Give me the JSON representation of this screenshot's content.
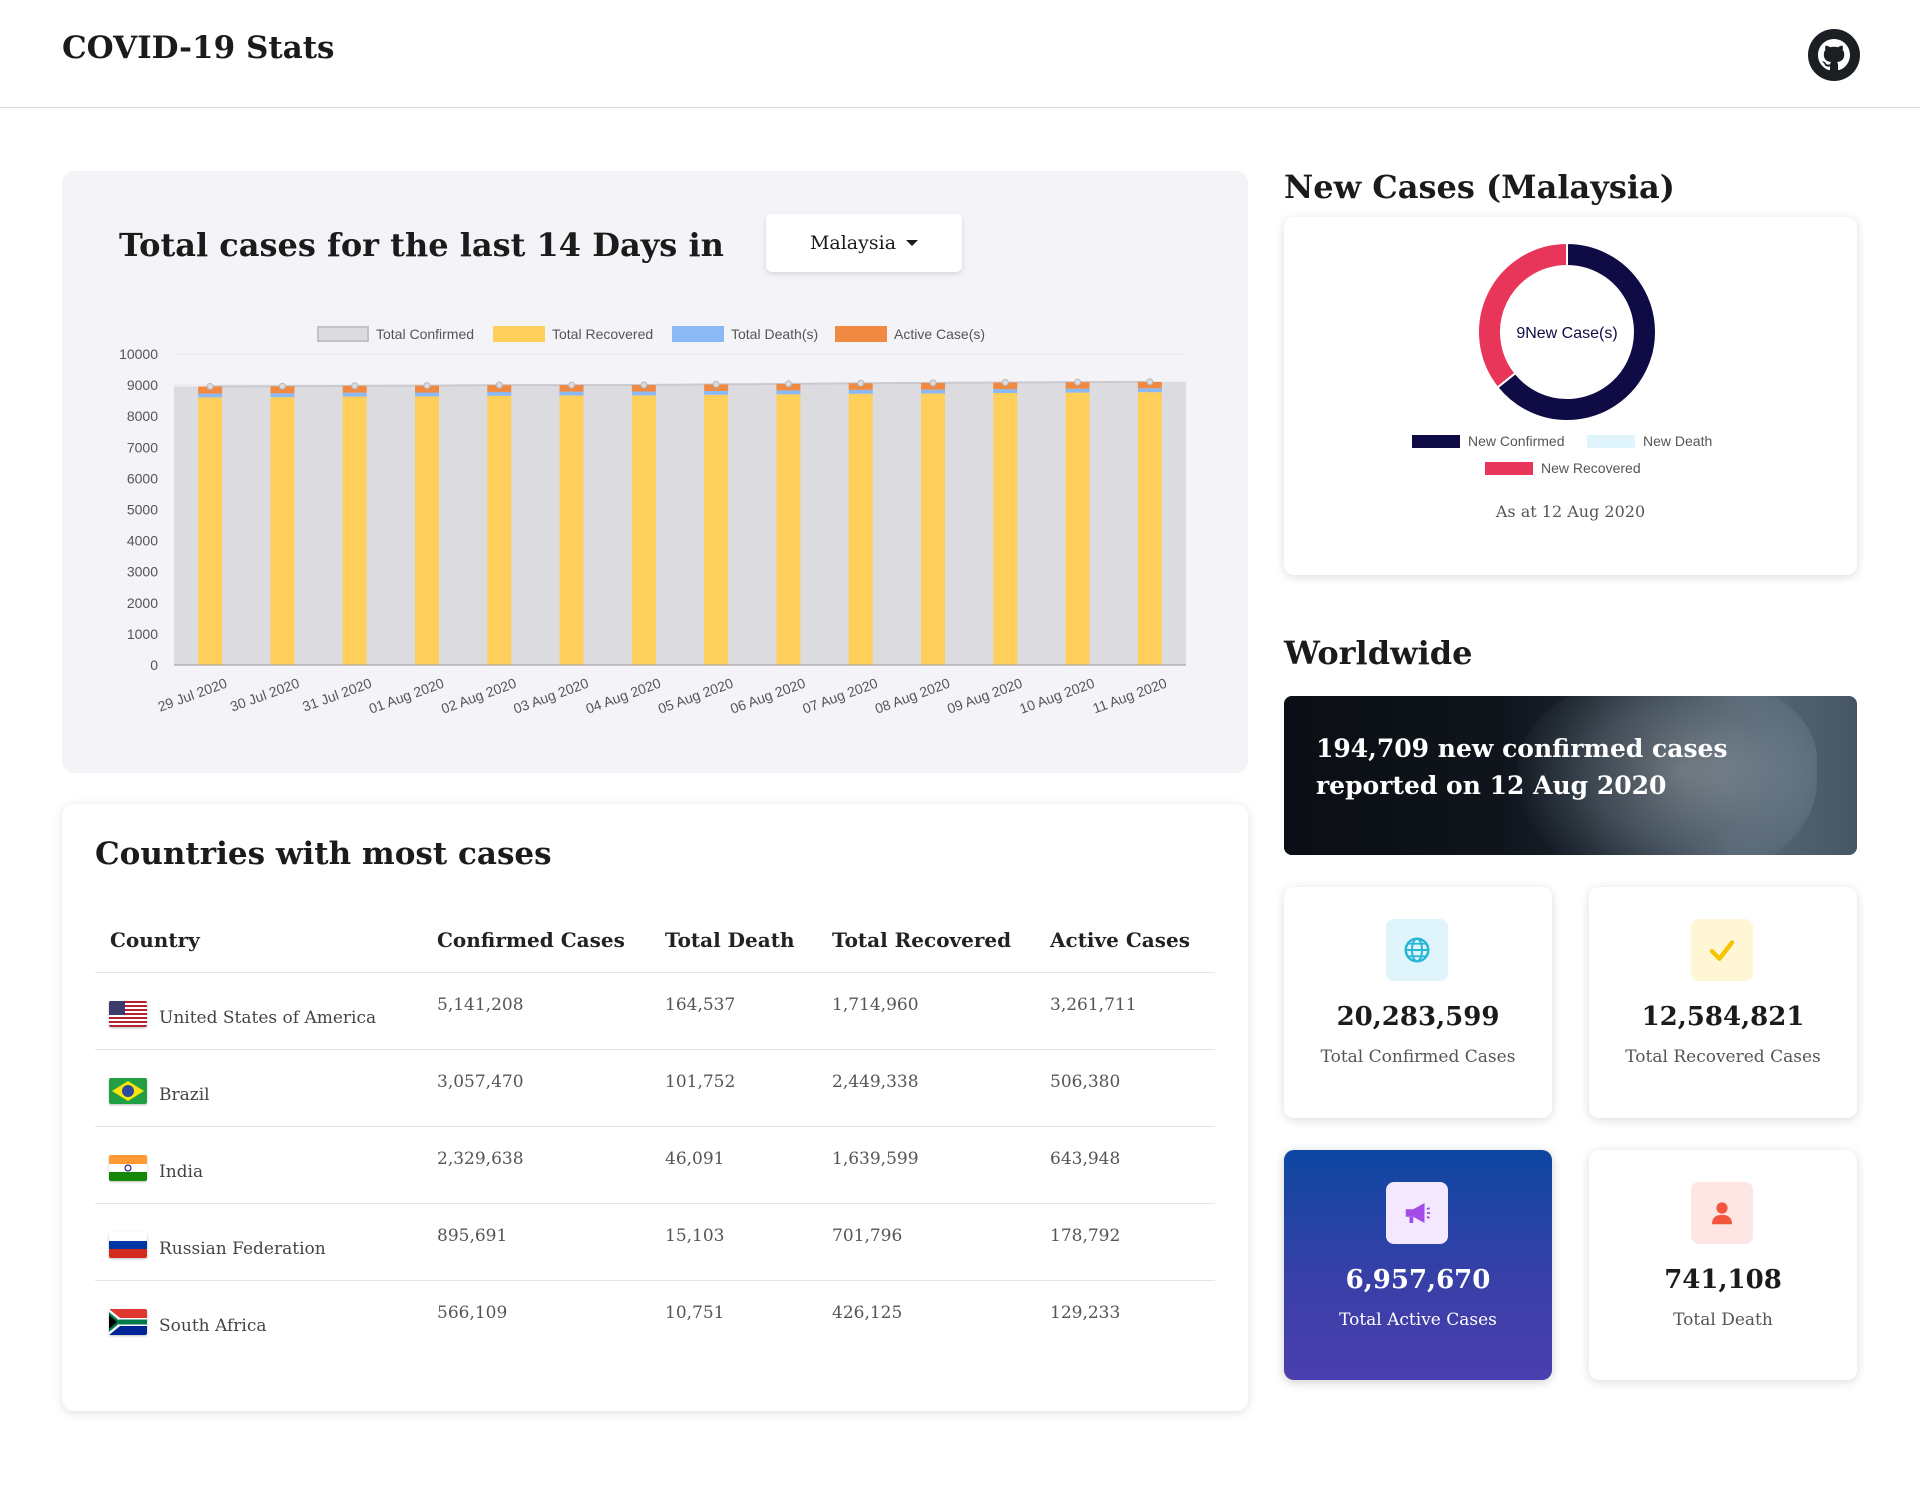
{
  "header": {
    "title": "COVID-19 Stats",
    "github_icon": "github-icon"
  },
  "chart_panel": {
    "title": "Total cases for the last 14 Days in",
    "country_select": {
      "selected": "Malaysia"
    }
  },
  "chart_data": {
    "type": "bar",
    "categories": [
      "29 Jul 2020",
      "30 Jul 2020",
      "31 Jul 2020",
      "01 Aug 2020",
      "02 Aug 2020",
      "03 Aug 2020",
      "04 Aug 2020",
      "05 Aug 2020",
      "06 Aug 2020",
      "07 Aug 2020",
      "08 Aug 2020",
      "09 Aug 2020",
      "10 Aug 2020",
      "11 Aug 2020"
    ],
    "series": [
      {
        "name": "Total Confirmed",
        "type": "area",
        "color": "#dcdce0",
        "values": [
          8956,
          8964,
          8976,
          8985,
          8999,
          9001,
          9002,
          9023,
          9038,
          9059,
          9072,
          9083,
          9094,
          9105
        ]
      },
      {
        "name": "Total Recovered",
        "type": "bar",
        "color": "#ffcf5c",
        "values": [
          8604,
          8613,
          8632,
          8636,
          8657,
          8666,
          8668,
          8688,
          8704,
          8723,
          8729,
          8746,
          8759,
          8773
        ]
      },
      {
        "name": "Total Death(s)",
        "type": "bar",
        "color": "#8ab9f5",
        "values": [
          124,
          124,
          124,
          124,
          124,
          124,
          124,
          124,
          125,
          125,
          125,
          125,
          125,
          125
        ]
      },
      {
        "name": "Active Case(s)",
        "type": "bar",
        "color": "#f08a42",
        "values": [
          228,
          227,
          220,
          225,
          218,
          211,
          210,
          211,
          209,
          211,
          218,
          212,
          210,
          207
        ]
      }
    ],
    "ylim": [
      0,
      10000
    ],
    "yticks": [
      0,
      1000,
      2000,
      3000,
      4000,
      5000,
      6000,
      7000,
      8000,
      9000,
      10000
    ],
    "legend": "top",
    "stacked": true
  },
  "table": {
    "title": "Countries with most cases",
    "headers": [
      "Country",
      "Confirmed Cases",
      "Total Death",
      "Total Recovered",
      "Active Cases"
    ],
    "rows": [
      {
        "flag": "usa-flag",
        "country": "United States of America",
        "confirmed": "5,141,208",
        "death": "164,537",
        "recovered": "1,714,960",
        "active": "3,261,711"
      },
      {
        "flag": "brazil-flag",
        "country": "Brazil",
        "confirmed": "3,057,470",
        "death": "101,752",
        "recovered": "2,449,338",
        "active": "506,380"
      },
      {
        "flag": "india-flag",
        "country": "India",
        "confirmed": "2,329,638",
        "death": "46,091",
        "recovered": "1,639,599",
        "active": "643,948"
      },
      {
        "flag": "russia-flag",
        "country": "Russian Federation",
        "confirmed": "895,691",
        "death": "15,103",
        "recovered": "701,796",
        "active": "178,792"
      },
      {
        "flag": "south-africa-flag",
        "country": "South Africa",
        "confirmed": "566,109",
        "death": "10,751",
        "recovered": "426,125",
        "active": "129,233"
      }
    ]
  },
  "new_cases": {
    "title": "New Cases (Malaysia)",
    "center_label": "9New Case(s)",
    "legend": [
      {
        "label": "New Confirmed",
        "color": "#0f0c45"
      },
      {
        "label": "New Death",
        "color": "#dff4fb"
      },
      {
        "label": "New Recovered",
        "color": "#e8365a"
      }
    ],
    "donut": {
      "new_confirmed": 9,
      "new_death": 0,
      "new_recovered": 5
    },
    "as_at": "As at 12 Aug 2020"
  },
  "worldwide": {
    "title": "Worldwide",
    "banner_text": "194,709 new confirmed cases reported on 12 Aug 2020",
    "stats": [
      {
        "icon": "globe-icon",
        "value": "20,283,599",
        "label": "Total Confirmed Cases",
        "icon_bg": "#e0f4fb",
        "icon_color": "#29b6d6"
      },
      {
        "icon": "checkmark-icon",
        "value": "12,584,821",
        "label": "Total Recovered Cases",
        "icon_bg": "#fff6d6",
        "icon_color": "#f5c400"
      },
      {
        "icon": "megaphone-icon",
        "value": "6,957,670",
        "label": "Total Active Cases",
        "icon_bg": "#f3e8fd",
        "icon_color": "#a24be8"
      },
      {
        "icon": "person-icon",
        "value": "741,108",
        "label": "Total Death",
        "icon_bg": "#fde6e3",
        "icon_color": "#f2563c"
      }
    ]
  }
}
